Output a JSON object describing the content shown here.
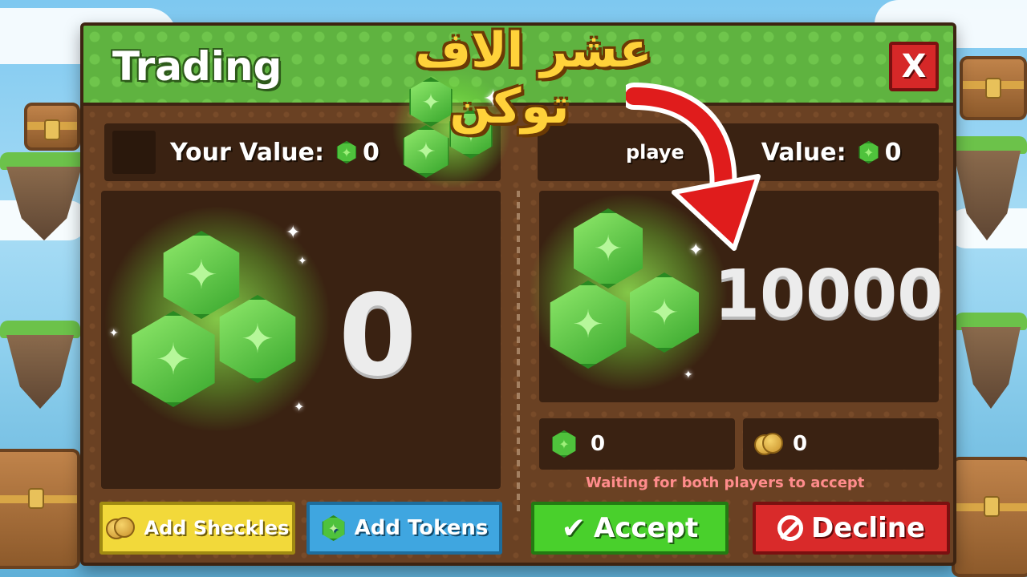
{
  "window": {
    "title": "Trading",
    "close_label": "X"
  },
  "overlay": {
    "headline_line1": "عشر الاف",
    "headline_line2": "توكن",
    "accent_color": "#ffd23a",
    "arrow_color": "#e01c1c"
  },
  "your_side": {
    "value_label": "Your Value:",
    "value": "0",
    "offer_amount": "0"
  },
  "other_side": {
    "value_label_fragment": "playe",
    "value_label": "Value:",
    "value": "0",
    "offer_amount": "10000",
    "tokens_count": "0",
    "sheckles_count": "0"
  },
  "status": {
    "waiting_text": "Waiting for both players to accept"
  },
  "buttons": {
    "add_sheckles": "Add Sheckles",
    "add_tokens": "Add Tokens",
    "accept": "Accept",
    "decline": "Decline"
  },
  "icons": {
    "token": "token-icon",
    "sheckle": "sheckle-coin-icon",
    "check": "check-icon",
    "decline": "no-sign-icon",
    "close": "close-icon",
    "arrow": "arrow-icon"
  },
  "colors": {
    "header_green": "#5fb340",
    "panel_brown": "#6a4123",
    "accept_green": "#49d02c",
    "decline_red": "#d92a2a",
    "sheckles_yellow": "#f2d93a",
    "tokens_blue": "#3fa6e0",
    "waiting_red": "#ff8c8c"
  }
}
